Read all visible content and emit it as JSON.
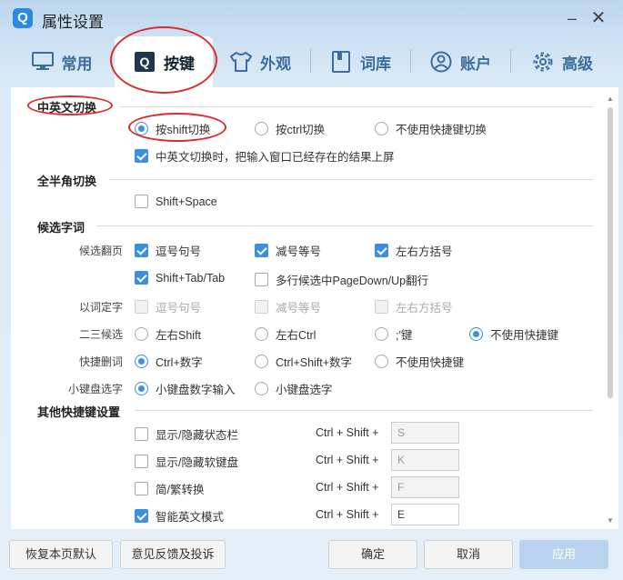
{
  "window": {
    "title": "属性设置",
    "logo": "Q",
    "minimize": "–",
    "close": "✕"
  },
  "tabs": [
    {
      "label": "常用",
      "icon": "monitor-icon"
    },
    {
      "label": "按键",
      "icon": "keyboard-q-icon",
      "active": true
    },
    {
      "label": "外观",
      "icon": "shirt-icon"
    },
    {
      "label": "词库",
      "icon": "book-icon"
    },
    {
      "label": "账户",
      "icon": "user-icon"
    },
    {
      "label": "高级",
      "icon": "gear-icon"
    }
  ],
  "sections": {
    "cn_en_switch": {
      "title": "中英文切换",
      "options": [
        "按shift切换",
        "按ctrl切换",
        "不使用快捷键切换"
      ],
      "selected": 0,
      "commit_checkbox": {
        "label": "中英文切换时，把输入窗口已经存在的结果上屏",
        "checked": true
      }
    },
    "full_half": {
      "title": "全半角切换",
      "shift_space": {
        "label": "Shift+Space",
        "checked": false
      }
    },
    "candidates": {
      "title": "候选字词",
      "page_label": "候选翻页",
      "page_opts": [
        {
          "label": "逗号句号",
          "checked": true
        },
        {
          "label": "减号等号",
          "checked": true
        },
        {
          "label": "左右方括号",
          "checked": true
        },
        {
          "label": "Shift+Tab/Tab",
          "checked": true
        },
        {
          "label": "多行候选中PageDown/Up翻行",
          "checked": false
        }
      ],
      "word_label": "以词定字",
      "word_opts": [
        "逗号句号",
        "减号等号",
        "左右方括号"
      ],
      "second_third_label": "二三候选",
      "second_third_opts": [
        "左右Shift",
        "左右Ctrl",
        ";'键",
        "不使用快捷键"
      ],
      "second_third_selected": 3,
      "delete_label": "快捷删词",
      "delete_opts": [
        "Ctrl+数字",
        "Ctrl+Shift+数字",
        "不使用快捷键"
      ],
      "delete_selected": 0,
      "numpad_label": "小键盘选字",
      "numpad_opts": [
        "小键盘数字输入",
        "小键盘选字"
      ],
      "numpad_selected": 0
    },
    "other_hotkeys": {
      "title": "其他快捷键设置",
      "combo": "Ctrl + Shift +",
      "items": [
        {
          "label": "显示/隐藏状态栏",
          "checked": false,
          "key": "S"
        },
        {
          "label": "显示/隐藏软键盘",
          "checked": false,
          "key": "K"
        },
        {
          "label": "简/繁转换",
          "checked": false,
          "key": "F"
        },
        {
          "label": "智能英文模式",
          "checked": true,
          "key": "E"
        }
      ]
    }
  },
  "footer": {
    "restore": "恢复本页默认",
    "feedback": "意见反馈及投诉",
    "ok": "确定",
    "cancel": "取消",
    "apply": "应用"
  },
  "colors": {
    "accent": "#3d8fe0",
    "annotation": "#e02a2a",
    "tab_text": "#3b6e9c"
  }
}
